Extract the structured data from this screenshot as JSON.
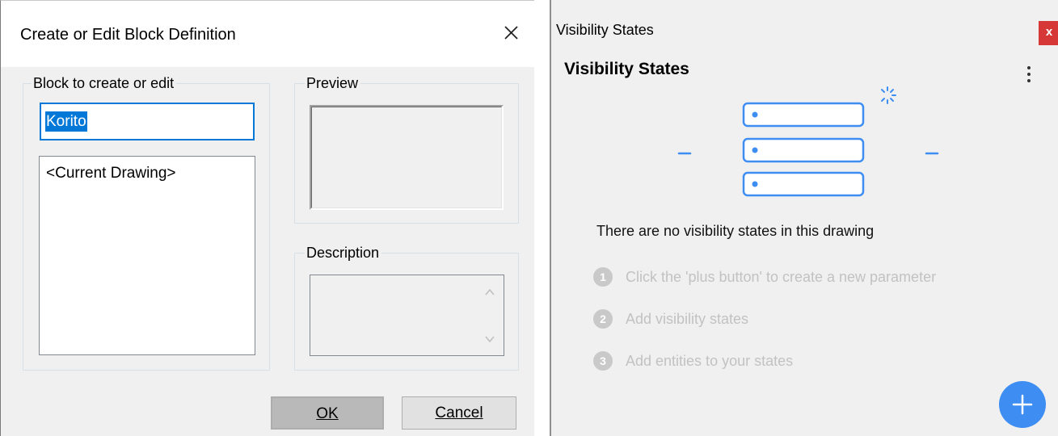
{
  "dialog": {
    "title": "Create or Edit Block Definition",
    "close_icon": "close-icon",
    "block_group_label": "Block to create or edit",
    "block_name_value": "Korito",
    "drawing_list": [
      "<Current Drawing>"
    ],
    "preview_group_label": "Preview",
    "description_group_label": "Description",
    "description_value": "",
    "ok_label": "OK",
    "cancel_label": "Cancel"
  },
  "visibility_panel": {
    "window_title": "Visibility States",
    "close_label": "x",
    "heading": "Visibility States",
    "menu_icon": "more-vertical-icon",
    "empty_message": "There are no visibility states in this drawing",
    "steps": [
      {
        "number": "1",
        "text": "Click the 'plus button' to create a new parameter"
      },
      {
        "number": "2",
        "text": "Add visibility states"
      },
      {
        "number": "3",
        "text": "Add entities to your states"
      }
    ],
    "add_icon": "plus-icon"
  },
  "colors": {
    "accent_blue": "#0078d7",
    "illustration_blue": "#3d8df3",
    "close_red": "#d63838",
    "step_gray": "#c2c2c2"
  }
}
